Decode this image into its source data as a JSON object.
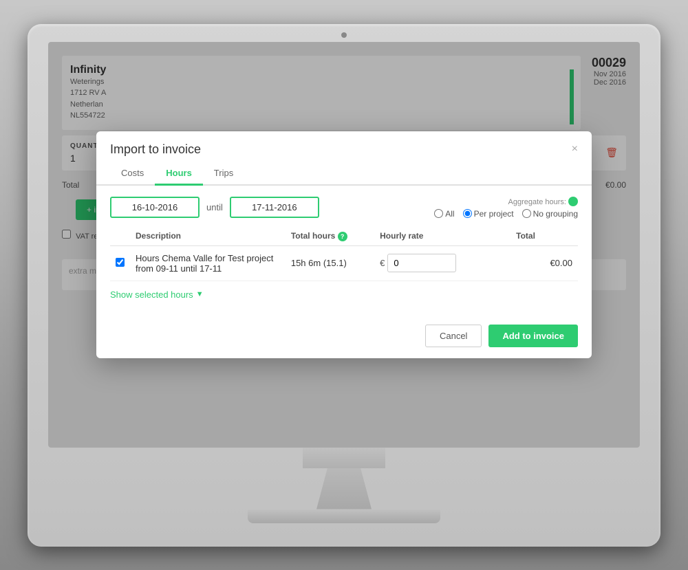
{
  "monitor": {
    "camera_label": "camera"
  },
  "background": {
    "company_name": "Infinity",
    "address_line1": "Weterings",
    "address_line2": "1712 RV A",
    "address_line3": "Netherlan",
    "address_line4": "NL554722",
    "invoice_number": "00029",
    "date1": "Nov 2016",
    "date2": "Dec 2016",
    "quantity_label": "QUANTITY",
    "quantity_value": "1",
    "total_label": "Total",
    "total_value": "€0.00",
    "import_button": "+ import",
    "vat_label": "VAT reversed charge",
    "extra_message_placeholder": "extra message"
  },
  "modal": {
    "title": "Import to invoice",
    "close_button": "×",
    "tabs": [
      {
        "label": "Costs",
        "active": false
      },
      {
        "label": "Hours",
        "active": true
      },
      {
        "label": "Trips",
        "active": false
      }
    ],
    "date_from": "16-10-2016",
    "date_until_label": "until",
    "date_to": "17-11-2016",
    "aggregate_label": "Aggregate hours:",
    "aggregate_options": [
      {
        "label": "All",
        "value": "all"
      },
      {
        "label": "Per project",
        "value": "per_project",
        "checked": true
      },
      {
        "label": "No grouping",
        "value": "no_grouping"
      }
    ],
    "table": {
      "columns": [
        {
          "label": "Description"
        },
        {
          "label": "Total hours"
        },
        {
          "label": "Hourly rate"
        },
        {
          "label": "Total"
        }
      ],
      "rows": [
        {
          "checked": true,
          "description": "Hours Chema Valle for Test project from 09-11 until 17-11",
          "total_hours": "15h 6m (15.1)",
          "hourly_rate_symbol": "€",
          "hourly_rate_value": "0",
          "total": "€0.00"
        }
      ]
    },
    "show_selected_label": "Show selected hours",
    "cancel_button": "Cancel",
    "add_button": "Add to invoice"
  }
}
